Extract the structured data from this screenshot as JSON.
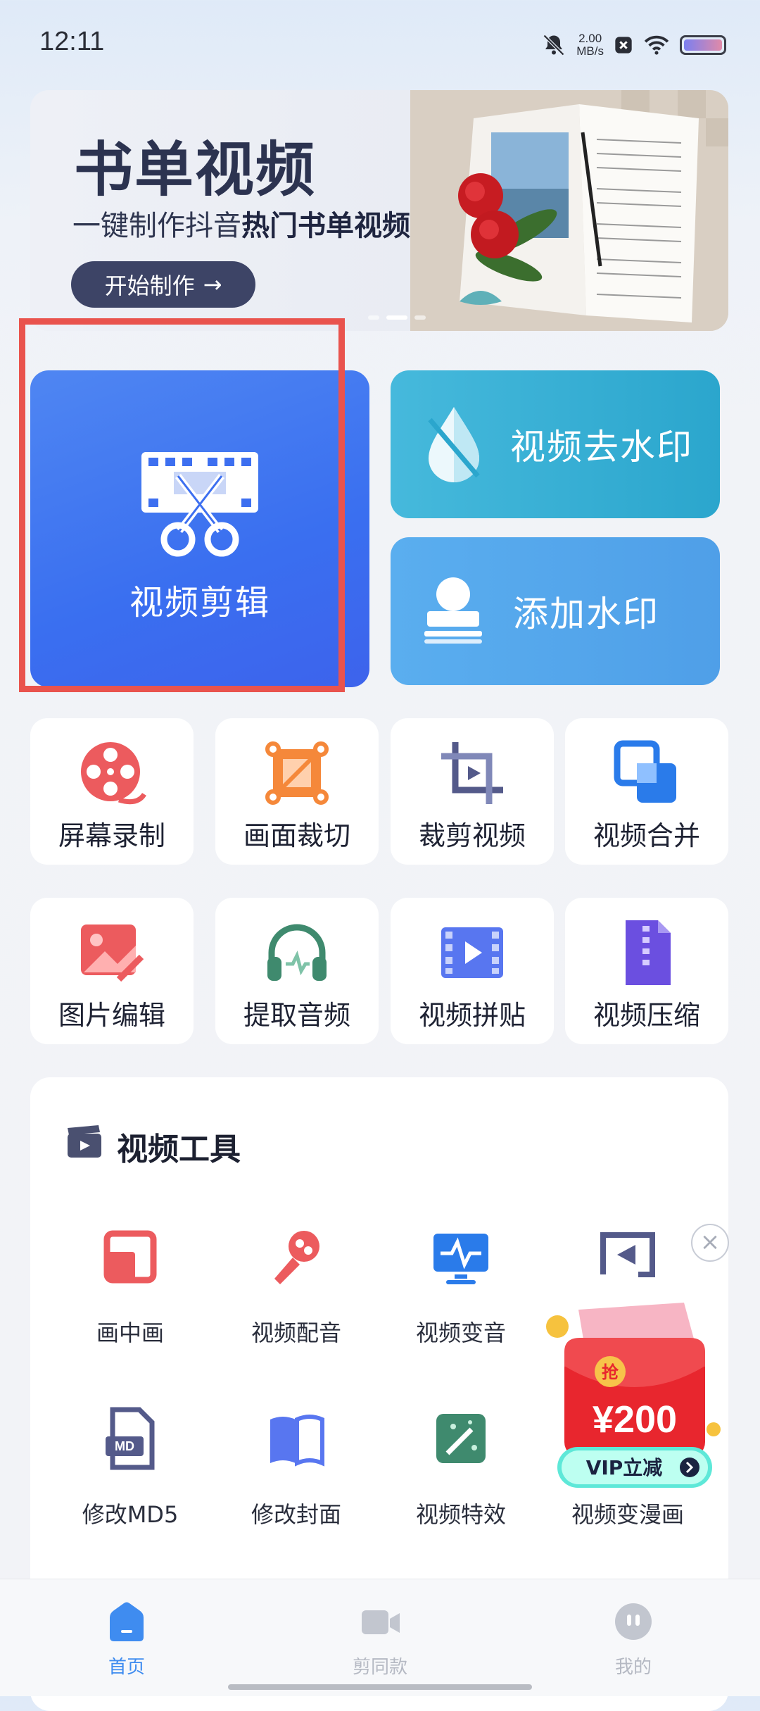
{
  "status_bar": {
    "time": "12:11",
    "speed_value": "2.00",
    "speed_unit": "MB/s",
    "icons": [
      "mute-bell-icon",
      "close-box-icon",
      "wifi-icon",
      "battery-icon"
    ]
  },
  "banner": {
    "title": "书单视频",
    "subtitle_plain": "一键制作抖音",
    "subtitle_bold": "热门书单视频",
    "button_label": "开始制作",
    "button_arrow": "→"
  },
  "main_cards": {
    "video_edit": "视频剪辑",
    "remove_watermark": "视频去水印",
    "add_watermark": "添加水印"
  },
  "grid": {
    "row1": [
      {
        "label": "屏幕录制",
        "icon": "film-reel-icon"
      },
      {
        "label": "画面裁切",
        "icon": "crop-frame-icon"
      },
      {
        "label": "裁剪视频",
        "icon": "crop-icon"
      },
      {
        "label": "视频合并",
        "icon": "merge-icon"
      }
    ],
    "row2": [
      {
        "label": "图片编辑",
        "icon": "image-edit-icon"
      },
      {
        "label": "提取音频",
        "icon": "headphones-icon"
      },
      {
        "label": "视频拼贴",
        "icon": "video-collage-icon"
      },
      {
        "label": "视频压缩",
        "icon": "zip-file-icon"
      }
    ]
  },
  "video_tools": {
    "title": "视频工具",
    "row1": [
      {
        "label": "画中画",
        "icon": "picture-in-picture-icon"
      },
      {
        "label": "视频配音",
        "icon": "microphone-icon"
      },
      {
        "label": "视频变音",
        "icon": "voice-change-icon"
      },
      {
        "label": "",
        "icon": "video-cast-icon"
      }
    ],
    "row2": [
      {
        "label": "修改MD5",
        "icon": "md-file-icon"
      },
      {
        "label": "修改封面",
        "icon": "book-cover-icon"
      },
      {
        "label": "视频特效",
        "icon": "magic-wand-icon"
      },
      {
        "label": "视频变漫画",
        "icon": "comic-icon"
      }
    ]
  },
  "promo": {
    "amount": "¥200",
    "badge": "抢",
    "button": "VIP立减"
  },
  "bottom_nav": [
    {
      "label": "首页",
      "icon": "home-icon",
      "active": true
    },
    {
      "label": "剪同款",
      "icon": "video-camera-icon",
      "active": false
    },
    {
      "label": "我的",
      "icon": "profile-icon",
      "active": false
    }
  ],
  "colors": {
    "edit_card": "#3d6ff0",
    "watermark_remove": "#2ba6cd",
    "watermark_add": "#4f9fe8",
    "highlight_box": "#e9534d",
    "nav_active": "#3f8cf0"
  }
}
